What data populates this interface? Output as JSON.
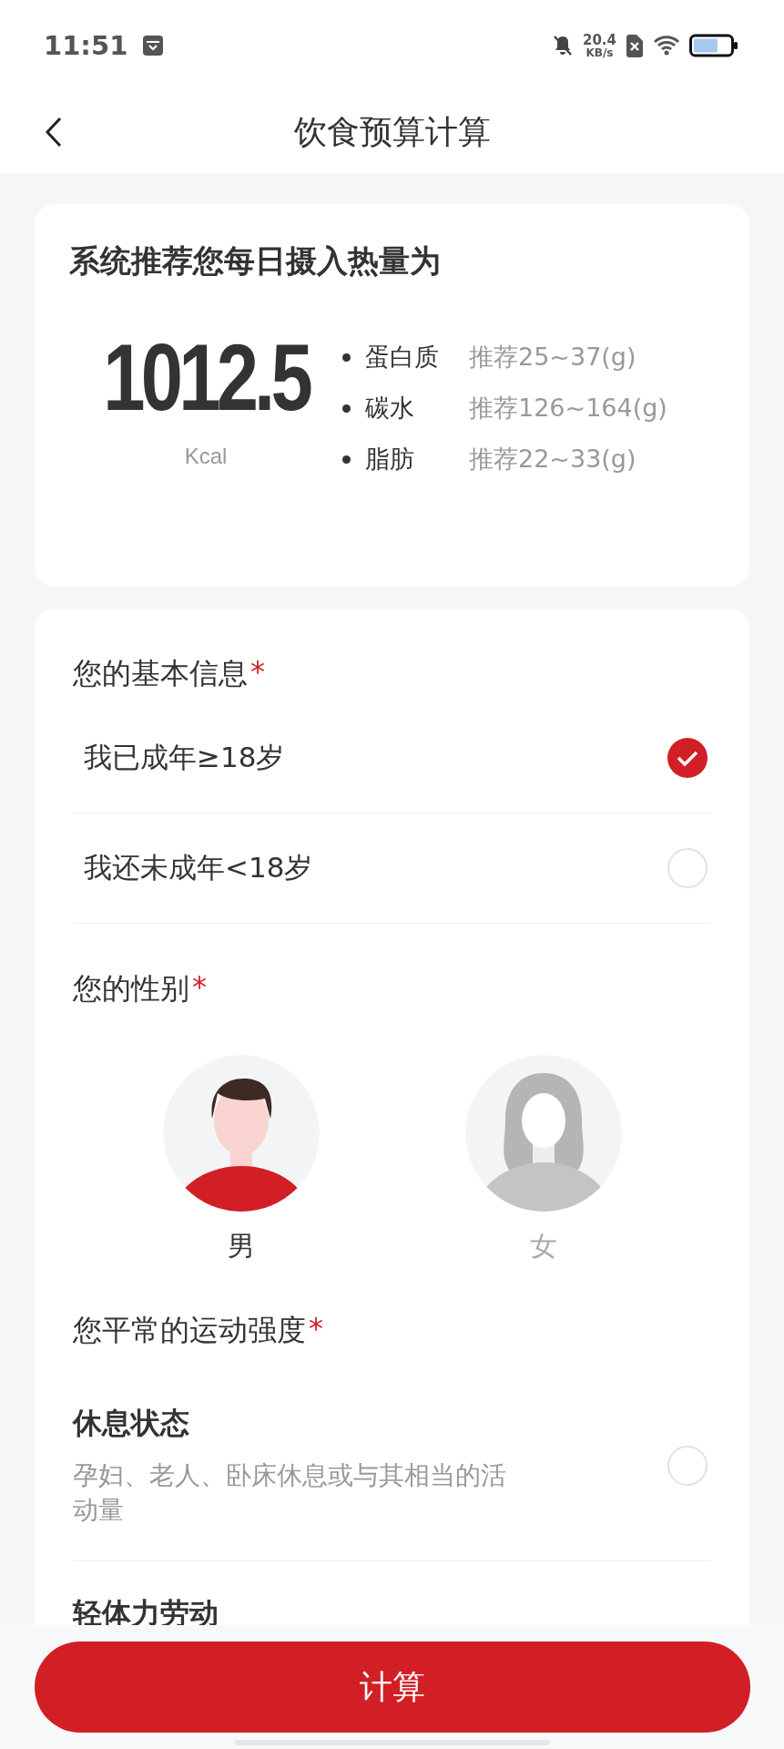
{
  "status_bar": {
    "time": "11:51",
    "net_speed": "20.4",
    "net_unit": "KB/s"
  },
  "header": {
    "title": "饮食预算计算"
  },
  "recommendation": {
    "title": "系统推荐您每日摄入热量为",
    "value": "1012.5",
    "unit": "Kcal",
    "macros": [
      {
        "name": "蛋白质",
        "range": "推荐25~37(g)"
      },
      {
        "name": "碳水",
        "range": "推荐126~164(g)"
      },
      {
        "name": "脂肪",
        "range": "推荐22~33(g)"
      }
    ]
  },
  "basic_info": {
    "title": "您的基本信息",
    "required_mark": "*",
    "options": [
      {
        "label": "我已成年≥18岁",
        "selected": true
      },
      {
        "label": "我还未成年<18岁",
        "selected": false
      }
    ]
  },
  "gender": {
    "title": "您的性别",
    "required_mark": "*",
    "options": [
      {
        "label": "男",
        "kind": "male",
        "selected": true
      },
      {
        "label": "女",
        "kind": "female",
        "selected": false
      }
    ]
  },
  "activity": {
    "title": "您平常的运动强度",
    "required_mark": "*",
    "options": [
      {
        "title": "休息状态",
        "description": "孕妇、老人、卧床休息或与其相当的活动量",
        "selected": false
      },
      {
        "title": "轻体力劳动"
      }
    ]
  },
  "action_button": "计算"
}
